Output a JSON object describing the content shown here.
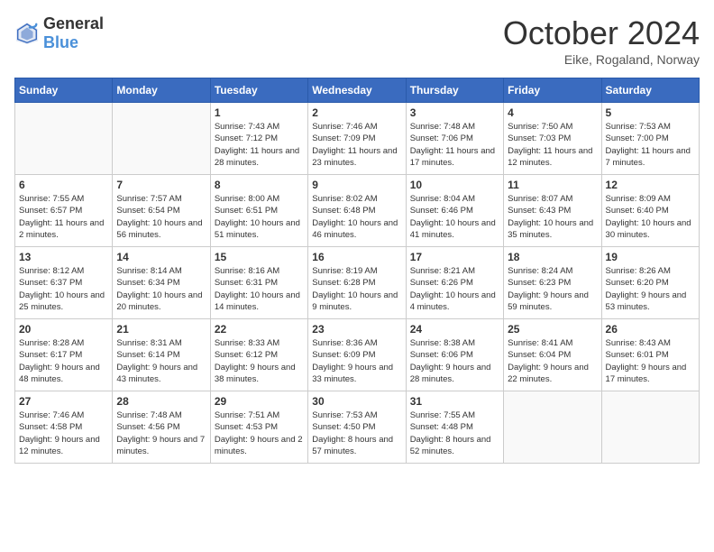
{
  "header": {
    "logo": {
      "text_general": "General",
      "text_blue": "Blue"
    },
    "title": "October 2024",
    "location": "Eike, Rogaland, Norway"
  },
  "weekdays": [
    "Sunday",
    "Monday",
    "Tuesday",
    "Wednesday",
    "Thursday",
    "Friday",
    "Saturday"
  ],
  "weeks": [
    [
      {
        "day": "",
        "empty": true
      },
      {
        "day": "",
        "empty": true
      },
      {
        "day": "1",
        "sunrise": "7:43 AM",
        "sunset": "7:12 PM",
        "daylight": "11 hours and 28 minutes."
      },
      {
        "day": "2",
        "sunrise": "7:46 AM",
        "sunset": "7:09 PM",
        "daylight": "11 hours and 23 minutes."
      },
      {
        "day": "3",
        "sunrise": "7:48 AM",
        "sunset": "7:06 PM",
        "daylight": "11 hours and 17 minutes."
      },
      {
        "day": "4",
        "sunrise": "7:50 AM",
        "sunset": "7:03 PM",
        "daylight": "11 hours and 12 minutes."
      },
      {
        "day": "5",
        "sunrise": "7:53 AM",
        "sunset": "7:00 PM",
        "daylight": "11 hours and 7 minutes."
      }
    ],
    [
      {
        "day": "6",
        "sunrise": "7:55 AM",
        "sunset": "6:57 PM",
        "daylight": "11 hours and 2 minutes."
      },
      {
        "day": "7",
        "sunrise": "7:57 AM",
        "sunset": "6:54 PM",
        "daylight": "10 hours and 56 minutes."
      },
      {
        "day": "8",
        "sunrise": "8:00 AM",
        "sunset": "6:51 PM",
        "daylight": "10 hours and 51 minutes."
      },
      {
        "day": "9",
        "sunrise": "8:02 AM",
        "sunset": "6:48 PM",
        "daylight": "10 hours and 46 minutes."
      },
      {
        "day": "10",
        "sunrise": "8:04 AM",
        "sunset": "6:46 PM",
        "daylight": "10 hours and 41 minutes."
      },
      {
        "day": "11",
        "sunrise": "8:07 AM",
        "sunset": "6:43 PM",
        "daylight": "10 hours and 35 minutes."
      },
      {
        "day": "12",
        "sunrise": "8:09 AM",
        "sunset": "6:40 PM",
        "daylight": "10 hours and 30 minutes."
      }
    ],
    [
      {
        "day": "13",
        "sunrise": "8:12 AM",
        "sunset": "6:37 PM",
        "daylight": "10 hours and 25 minutes."
      },
      {
        "day": "14",
        "sunrise": "8:14 AM",
        "sunset": "6:34 PM",
        "daylight": "10 hours and 20 minutes."
      },
      {
        "day": "15",
        "sunrise": "8:16 AM",
        "sunset": "6:31 PM",
        "daylight": "10 hours and 14 minutes."
      },
      {
        "day": "16",
        "sunrise": "8:19 AM",
        "sunset": "6:28 PM",
        "daylight": "10 hours and 9 minutes."
      },
      {
        "day": "17",
        "sunrise": "8:21 AM",
        "sunset": "6:26 PM",
        "daylight": "10 hours and 4 minutes."
      },
      {
        "day": "18",
        "sunrise": "8:24 AM",
        "sunset": "6:23 PM",
        "daylight": "9 hours and 59 minutes."
      },
      {
        "day": "19",
        "sunrise": "8:26 AM",
        "sunset": "6:20 PM",
        "daylight": "9 hours and 53 minutes."
      }
    ],
    [
      {
        "day": "20",
        "sunrise": "8:28 AM",
        "sunset": "6:17 PM",
        "daylight": "9 hours and 48 minutes."
      },
      {
        "day": "21",
        "sunrise": "8:31 AM",
        "sunset": "6:14 PM",
        "daylight": "9 hours and 43 minutes."
      },
      {
        "day": "22",
        "sunrise": "8:33 AM",
        "sunset": "6:12 PM",
        "daylight": "9 hours and 38 minutes."
      },
      {
        "day": "23",
        "sunrise": "8:36 AM",
        "sunset": "6:09 PM",
        "daylight": "9 hours and 33 minutes."
      },
      {
        "day": "24",
        "sunrise": "8:38 AM",
        "sunset": "6:06 PM",
        "daylight": "9 hours and 28 minutes."
      },
      {
        "day": "25",
        "sunrise": "8:41 AM",
        "sunset": "6:04 PM",
        "daylight": "9 hours and 22 minutes."
      },
      {
        "day": "26",
        "sunrise": "8:43 AM",
        "sunset": "6:01 PM",
        "daylight": "9 hours and 17 minutes."
      }
    ],
    [
      {
        "day": "27",
        "sunrise": "7:46 AM",
        "sunset": "4:58 PM",
        "daylight": "9 hours and 12 minutes."
      },
      {
        "day": "28",
        "sunrise": "7:48 AM",
        "sunset": "4:56 PM",
        "daylight": "9 hours and 7 minutes."
      },
      {
        "day": "29",
        "sunrise": "7:51 AM",
        "sunset": "4:53 PM",
        "daylight": "9 hours and 2 minutes."
      },
      {
        "day": "30",
        "sunrise": "7:53 AM",
        "sunset": "4:50 PM",
        "daylight": "8 hours and 57 minutes."
      },
      {
        "day": "31",
        "sunrise": "7:55 AM",
        "sunset": "4:48 PM",
        "daylight": "8 hours and 52 minutes."
      },
      {
        "day": "",
        "empty": true
      },
      {
        "day": "",
        "empty": true
      }
    ]
  ]
}
